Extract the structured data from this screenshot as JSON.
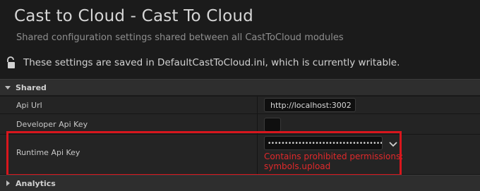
{
  "header": {
    "title": "Cast to Cloud - Cast To Cloud",
    "subtitle": "Shared configuration settings shared between all CastToCloud modules",
    "save_notice": "These settings are saved in DefaultCastToCloud.ini, which is currently writable."
  },
  "sections": {
    "shared": {
      "label": "Shared",
      "expanded": true
    },
    "analytics": {
      "label": "Analytics",
      "expanded": false
    }
  },
  "settings": {
    "api_url": {
      "label": "Api Url",
      "value": "http://localhost:3002"
    },
    "developer_api_key": {
      "label": "Developer Api Key"
    },
    "runtime_api_key": {
      "label": "Runtime Api Key",
      "value": "••••••••••••••••••••••••••••••••••••••••••",
      "error": "Contains prohibited permissions: symbols.upload"
    }
  },
  "icons": {
    "lock": "lock-icon",
    "expand": "triangle-down-icon",
    "collapse": "triangle-right-icon",
    "dropdown": "chevron-down-icon"
  },
  "colors": {
    "error": "#e0292b",
    "highlight_box": "#d8161d"
  }
}
